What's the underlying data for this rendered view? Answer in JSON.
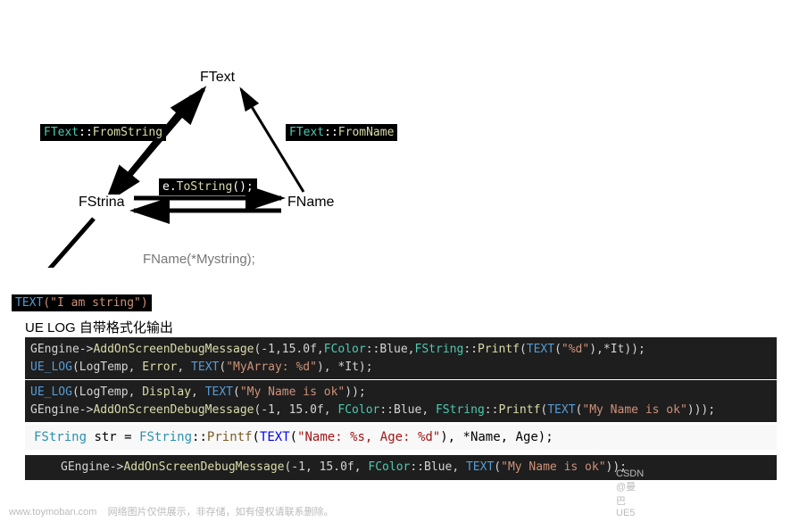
{
  "diagram": {
    "nodes": {
      "ftext": "FText",
      "fstring": "FStrina",
      "fname": "FName"
    },
    "edges": {
      "ftext_fromstring": "FText::FromString",
      "ftext_fromname": "FText::FromName",
      "tostring": "e.ToString();",
      "fname_ctor": "FName(*Mystring);"
    },
    "bottom_chip_prefix": "TEXT",
    "bottom_chip_args": "(\"I am string\")"
  },
  "heading": "UE LOG 自带格式化输出",
  "code": {
    "block1": {
      "line1": {
        "p1": "GEngine->",
        "fn": "AddOnScreenDebugMessage",
        "p2": "(-1,15.0f,",
        "fc": "FColor",
        "p3": "::Blue,",
        "fs": "FString",
        "p4": "::",
        "pf": "Printf",
        "p5": "(",
        "tx": "TEXT",
        "p6": "(",
        "str": "\"%d\"",
        "p7": "),*It));"
      },
      "line2": {
        "mac": "UE_LOG",
        "p1": "(LogTemp, ",
        "err": "Error",
        "p2": ", ",
        "tx": "TEXT",
        "p3": "(",
        "str": "\"MyArray: %d\"",
        "p4": "), *It);"
      }
    },
    "block2": {
      "line1": {
        "mac": "UE_LOG",
        "p1": "(LogTemp, ",
        "disp": "Display",
        "p2": ", ",
        "tx": "TEXT",
        "p3": "(",
        "str": "\"My Name is ok\"",
        "p4": "));"
      },
      "line2": {
        "p1": "GEngine->",
        "fn": "AddOnScreenDebugMessage",
        "p2": "(-1, 15.0f, ",
        "fc": "FColor",
        "p3": "::Blue, ",
        "fs": "FString",
        "p4": "::",
        "pf": "Printf",
        "p5": "(",
        "tx": "TEXT",
        "p6": "(",
        "str": "\"My Name is ok\"",
        "p7": ")));"
      }
    },
    "light": {
      "type": "FString",
      "v": " str = ",
      "type2": "FString",
      "colon": "::",
      "pf": "Printf",
      "p1": "(",
      "tx": "TEXT",
      "p2": "(",
      "str": "\"Name: %s, Age: %d\"",
      "p3": "), *Name, Age);"
    },
    "block3": {
      "p1": "GEngine->",
      "fn": "AddOnScreenDebugMessage",
      "p2": "(-1, 15.0f, ",
      "fc": "FColor",
      "p3": "::Blue, ",
      "tx": "TEXT",
      "p4": "(",
      "str": "\"My Name is ok\"",
      "p5": "));"
    }
  },
  "footer": {
    "site": "www.toymoban.com",
    "text": "网络图片仅供展示，非存储，如有侵权请联系删除。",
    "right": "CSDN @曼巴UE5"
  }
}
